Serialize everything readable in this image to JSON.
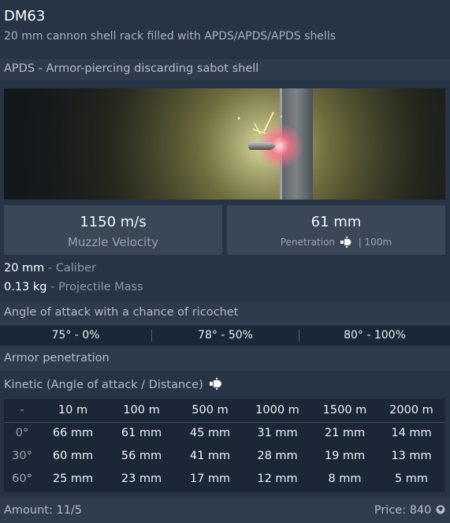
{
  "header": {
    "title": "DM63",
    "subtitle": "20 mm cannon shell rack filled with APDS/APDS/APDS shells"
  },
  "shell": {
    "type_label": "APDS - Armor-piercing discarding sabot shell"
  },
  "stats": {
    "velocity_value": "1150 m/s",
    "velocity_label": "Muzzle Velocity",
    "penetration_value": "61 mm",
    "penetration_label": "Penetration",
    "penetration_distance": "| 100m"
  },
  "props": {
    "caliber_value": "20 mm",
    "caliber_label": "Caliber",
    "mass_value": "0.13 kg",
    "mass_label": "Projectile Mass",
    "separator": " - "
  },
  "ricochet": {
    "heading": "Angle of attack with a chance of ricochet",
    "cells": [
      "75° - 0%",
      "78° - 50%",
      "80° - 100%"
    ]
  },
  "armor": {
    "heading": "Armor penetration",
    "kinetic_label": "Kinetic (Angle of attack / Distance)",
    "columns": [
      "-",
      "10 m",
      "100 m",
      "500 m",
      "1000 m",
      "1500 m",
      "2000 m"
    ],
    "rows": [
      {
        "angle": "0°",
        "values": [
          "66 mm",
          "61 mm",
          "45 mm",
          "31 mm",
          "21 mm",
          "14 mm"
        ]
      },
      {
        "angle": "30°",
        "values": [
          "60 mm",
          "56 mm",
          "41 mm",
          "28 mm",
          "19 mm",
          "13 mm"
        ]
      },
      {
        "angle": "60°",
        "values": [
          "25 mm",
          "23 mm",
          "17 mm",
          "12 mm",
          "8 mm",
          "5 mm"
        ]
      }
    ]
  },
  "footer": {
    "amount": "Amount: 11/5",
    "price": "Price: 840"
  },
  "icons": {
    "penetration": "shell-penetration-icon",
    "kinetic": "shell-penetration-icon",
    "currency": "silver-lions-icon"
  },
  "colors": {
    "background": "#263445",
    "band": "#2d3b4c",
    "stat_box": "#3a4757",
    "table_bg": "#1b2736"
  }
}
